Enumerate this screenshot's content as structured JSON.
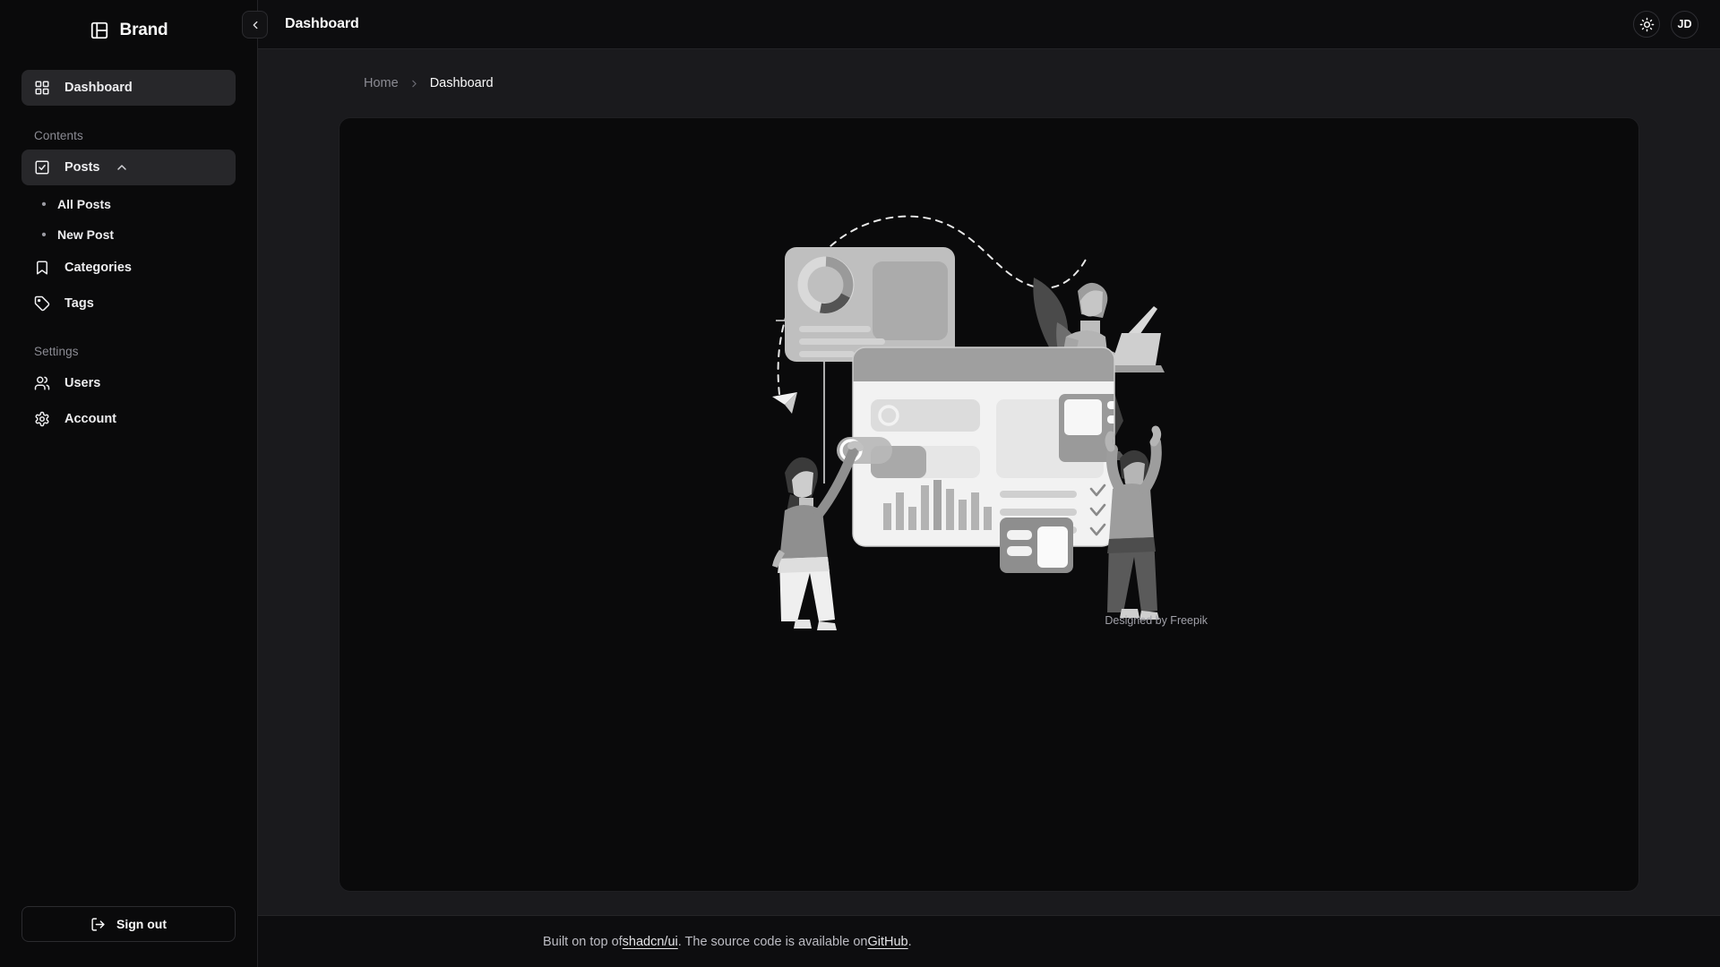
{
  "sidebar": {
    "brand": {
      "name": "Brand",
      "icon": "panel-layout-icon"
    },
    "primary": [
      {
        "label": "Dashboard",
        "icon": "grid-icon",
        "active": true
      }
    ],
    "groups": [
      {
        "label": "Contents",
        "items": [
          {
            "label": "Posts",
            "icon": "square-check-icon",
            "expanded": true,
            "chevron": "chevron-up-icon"
          },
          {
            "label": "All Posts",
            "icon": "bullet-dot",
            "sub": true
          },
          {
            "label": "New Post",
            "icon": "bullet-dot",
            "sub": true
          },
          {
            "label": "Categories",
            "icon": "bookmark-icon"
          },
          {
            "label": "Tags",
            "icon": "tag-icon"
          }
        ]
      },
      {
        "label": "Settings",
        "items": [
          {
            "label": "Users",
            "icon": "users-icon"
          },
          {
            "label": "Account",
            "icon": "gear-icon"
          }
        ]
      }
    ],
    "signout": {
      "label": "Sign out",
      "icon": "log-out-icon"
    }
  },
  "topbar": {
    "collapse_icon": "chevron-left-icon",
    "title": "Dashboard",
    "theme_toggle_icon": "sun-icon",
    "avatar_initials": "JD"
  },
  "breadcrumb": {
    "home": "Home",
    "separator_icon": "chevron-right-icon",
    "current": "Dashboard"
  },
  "main": {
    "illustration_caption": "Designed by Freepik"
  },
  "footer": {
    "prefix": "Built on top of ",
    "link1": "shadcn/ui",
    "middle": ". The source code is available on ",
    "link2": "GitHub",
    "suffix": "."
  },
  "colors": {
    "page_bg": "#1a1a1d",
    "sidebar_bg": "#0a0a0b",
    "card_bg": "#0a0a0b",
    "topbar_bg": "#0d0d0f",
    "active_item_bg": "#27272a",
    "text_primary": "#fafafa",
    "text_muted": "#8b8b93",
    "border": "#242427"
  }
}
